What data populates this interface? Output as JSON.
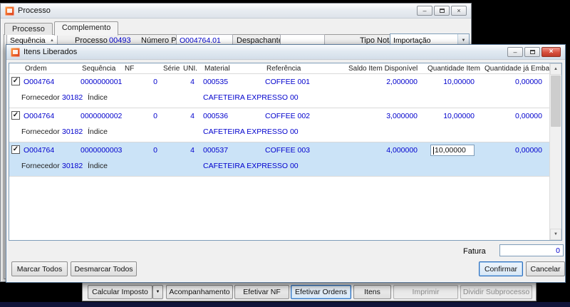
{
  "icons": {
    "checkmark": "✓",
    "dropdown_arrow": "▼",
    "sort_caret": "▲",
    "scroll_up": "▲",
    "scroll_down": "▼",
    "minimize": "–",
    "close": "×"
  },
  "process_window": {
    "title": "Processo",
    "tabs": [
      "Processo",
      "Complemento"
    ],
    "form": {
      "sequencia_label": "Sequência",
      "processo_label": "Processo",
      "processo_value": "00493",
      "numero_po_label": "Número PO",
      "numero_po_value": "O004764.01",
      "despachante_label": "Despachante",
      "despachante_value": "",
      "tipo_nota_label": "Tipo Nota",
      "tipo_nota_value": "Importação"
    }
  },
  "dialog": {
    "title": "Itens Liberados",
    "columns": [
      "Ordem",
      "Sequência",
      "NF",
      "Série",
      "UNI.",
      "Material",
      "Referência",
      "Saldo Item Disponível",
      "Quantidade Item",
      "Quantidade já Embarcada"
    ],
    "row_labels": {
      "fornecedor": "Fornecedor",
      "indice": "Índice"
    },
    "rows": [
      {
        "checked": true,
        "selected": false,
        "editing": false,
        "ordem": "O004764",
        "sequencia": "0000000001",
        "nf": "0",
        "serie": "",
        "uni": "4",
        "material": "000535",
        "referencia": "COFFEE 001",
        "saldo": "2,000000",
        "quantidade": "10,00000",
        "embarcada": "0,00000",
        "fornecedor": "30182",
        "descricao": "CAFETEIRA EXPRESSO 00"
      },
      {
        "checked": true,
        "selected": false,
        "editing": false,
        "ordem": "O004764",
        "sequencia": "0000000002",
        "nf": "0",
        "serie": "",
        "uni": "4",
        "material": "000536",
        "referencia": "COFFEE 002",
        "saldo": "3,000000",
        "quantidade": "10,00000",
        "embarcada": "0,00000",
        "fornecedor": "30182",
        "descricao": "CAFETEIRA EXPRESSO 00"
      },
      {
        "checked": true,
        "selected": true,
        "editing": true,
        "ordem": "O004764",
        "sequencia": "0000000003",
        "nf": "0",
        "serie": "",
        "uni": "4",
        "material": "000537",
        "referencia": "COFFEE 003",
        "saldo": "4,000000",
        "quantidade": "10,00000",
        "embarcada": "0,00000",
        "fornecedor": "30182",
        "descricao": "CAFETEIRA EXPRESSO 00"
      }
    ],
    "fatura_label": "Fatura",
    "fatura_value": "0",
    "buttons": {
      "marcar_todos": "Marcar Todos",
      "desmarcar_todos": "Desmarcar Todos",
      "confirmar": "Confirmar",
      "cancelar": "Cancelar"
    }
  },
  "toolbar": {
    "buttons": [
      {
        "label": "Calcular Imposto",
        "split": true
      },
      {
        "label": "Acompanhamento"
      },
      {
        "label": "Efetivar NF"
      },
      {
        "label": "Efetivar Ordens",
        "focused": true
      },
      {
        "label": "Itens"
      },
      {
        "label": "Imprimir",
        "disabled": true
      },
      {
        "label": "Dividir Subprocesso",
        "disabled": true
      }
    ]
  }
}
